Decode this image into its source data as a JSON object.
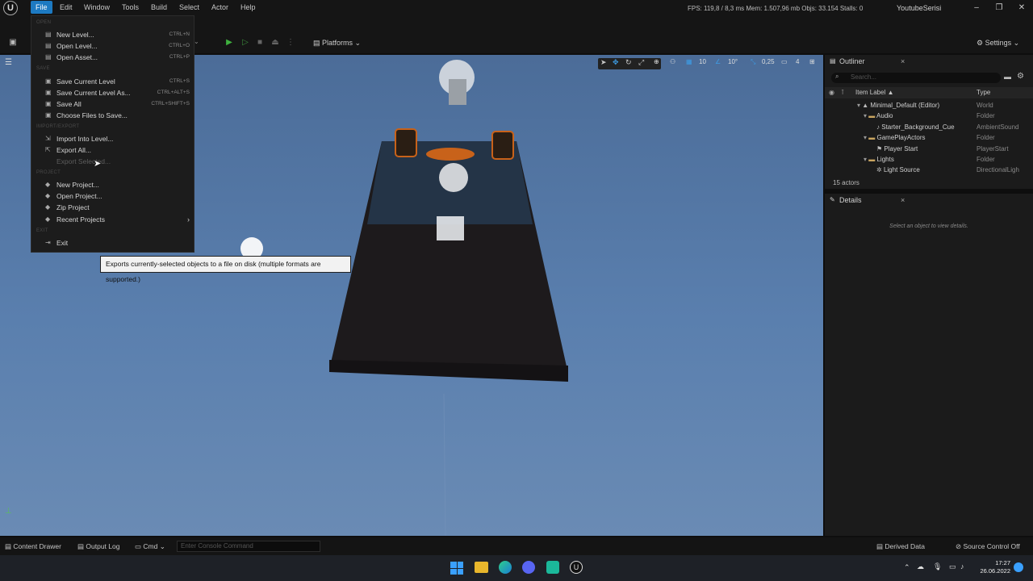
{
  "app": {
    "logo": "U"
  },
  "menubar": {
    "items": [
      "File",
      "Edit",
      "Window",
      "Tools",
      "Build",
      "Select",
      "Actor",
      "Help"
    ]
  },
  "stats": "FPS: 119,8  /  8,3 ms    Mem: 1.507,96 mb    Objs: 33.154    Stalls: 0",
  "project_name": "YoutubeSerisi",
  "toolbar": {
    "platforms": "Platforms",
    "settings": "Settings"
  },
  "viewport": {
    "snap_grid": "10",
    "snap_angle": "10°",
    "snap_scale": "0,25",
    "cam_speed": "4"
  },
  "outliner": {
    "title": "Outliner",
    "search_placeholder": "Search...",
    "col_label": "Item Label ▲",
    "col_type": "Type",
    "rows": [
      {
        "label": "Minimal_Default (Editor)",
        "type": "World",
        "icon": "▲"
      },
      {
        "label": "Audio",
        "type": "Folder",
        "icon": "▬"
      },
      {
        "label": "Starter_Background_Cue",
        "type": "AmbientSound",
        "icon": "♪"
      },
      {
        "label": "GamePlayActors",
        "type": "Folder",
        "icon": "▬"
      },
      {
        "label": "Player Start",
        "type": "PlayerStart",
        "icon": "⚑"
      },
      {
        "label": "Lights",
        "type": "Folder",
        "icon": "▬"
      },
      {
        "label": "Light Source",
        "type": "DirectionalLigh",
        "icon": "✲"
      }
    ],
    "count": "15 actors"
  },
  "details": {
    "title": "Details",
    "empty": "Select an object to view details."
  },
  "file_menu": {
    "sections": [
      {
        "header": "OPEN",
        "items": [
          {
            "label": "New Level...",
            "shortcut": "CTRL+N",
            "icon": "▤"
          },
          {
            "label": "Open Level...",
            "shortcut": "CTRL+O",
            "icon": "▤"
          },
          {
            "label": "Open Asset...",
            "shortcut": "CTRL+P",
            "icon": "▤"
          }
        ]
      },
      {
        "header": "SAVE",
        "items": [
          {
            "label": "Save Current Level",
            "shortcut": "CTRL+S",
            "icon": "▣"
          },
          {
            "label": "Save Current Level As...",
            "shortcut": "CTRL+ALT+S",
            "icon": "▣"
          },
          {
            "label": "Save All",
            "shortcut": "CTRL+SHIFT+S",
            "icon": "▣"
          },
          {
            "label": "Choose Files to Save...",
            "shortcut": "",
            "icon": "▣"
          }
        ]
      },
      {
        "header": "IMPORT/EXPORT",
        "items": [
          {
            "label": "Import Into Level...",
            "shortcut": "",
            "icon": "⇲"
          },
          {
            "label": "Export All...",
            "shortcut": "",
            "icon": "⇱"
          },
          {
            "label": "Export Selected...",
            "shortcut": "",
            "icon": "",
            "disabled": true
          }
        ]
      },
      {
        "header": "PROJECT",
        "items": [
          {
            "label": "New Project...",
            "shortcut": "",
            "icon": "◆"
          },
          {
            "label": "Open Project...",
            "shortcut": "",
            "icon": "◆"
          },
          {
            "label": "Zip Project",
            "shortcut": "",
            "icon": "◆"
          },
          {
            "label": "Recent Projects",
            "shortcut": "",
            "icon": "◆",
            "submenu": true
          }
        ]
      },
      {
        "header": "EXIT",
        "items": [
          {
            "label": "Exit",
            "shortcut": "",
            "icon": "⇥"
          }
        ]
      }
    ]
  },
  "tooltip": "Exports currently-selected objects to a file on disk (multiple formats are supported.)",
  "statusbar": {
    "content_drawer": "Content Drawer",
    "output_log": "Output Log",
    "cmd": "Cmd",
    "console_placeholder": "Enter Console Command",
    "derived_data": "Derived Data",
    "source_control": "Source Control Off"
  },
  "taskbar": {
    "time": "17:27",
    "date": "26.06.2022"
  }
}
